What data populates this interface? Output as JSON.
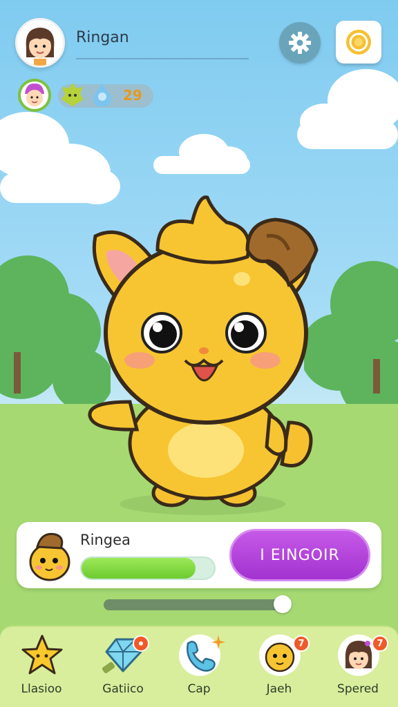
{
  "header": {
    "username": "Ringan",
    "currency_count": "29"
  },
  "pet": {
    "name": "Ringea",
    "progress": 0.86,
    "action_label": "I EINGOIR"
  },
  "slider": {
    "value": 0.95
  },
  "nav": {
    "items": [
      {
        "label": "Llasioo",
        "icon": "star-icon"
      },
      {
        "label": "Gatiico",
        "icon": "crystal-icon",
        "badge": ""
      },
      {
        "label": "Cap",
        "icon": "phone-icon",
        "badge": ""
      },
      {
        "label": "Jaeh",
        "icon": "pet-face-icon",
        "badge": "7"
      },
      {
        "label": "Spered",
        "icon": "girl-avatar-icon",
        "badge": "7"
      }
    ]
  },
  "colors": {
    "sky": "#8fd2f2",
    "grass": "#a2d76f",
    "accent_purple": "#b547dc",
    "progress_green": "#7fd83d",
    "pet_yellow": "#f7c531"
  }
}
